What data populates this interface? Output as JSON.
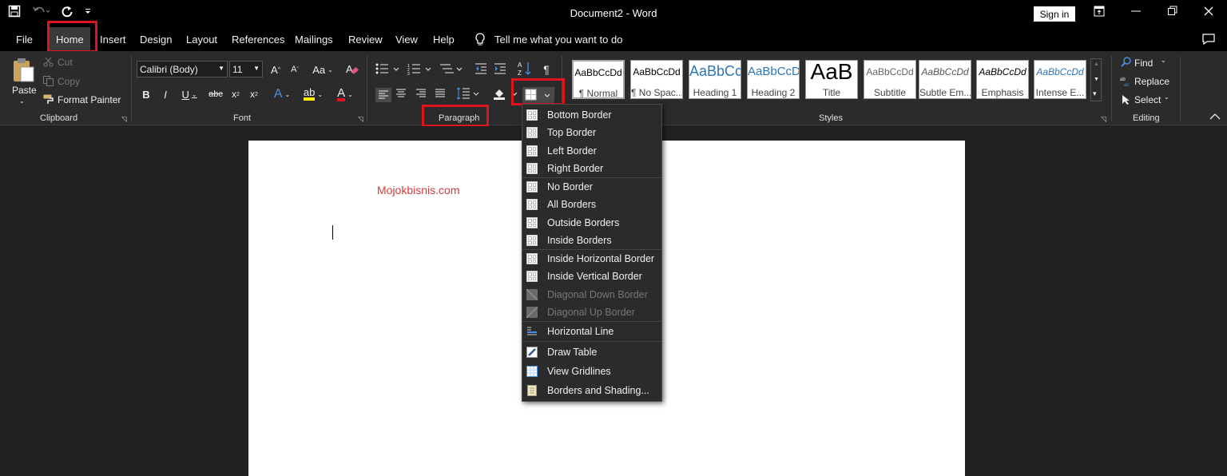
{
  "titlebar": {
    "title": "Document2  -  Word",
    "signin": "Sign in"
  },
  "menu": {
    "tabs": [
      "File",
      "Home",
      "Insert",
      "Design",
      "Layout",
      "References",
      "Mailings",
      "Review",
      "View",
      "Help"
    ],
    "tellme": "Tell me what you want to do"
  },
  "ribbon": {
    "clipboard": {
      "paste": "Paste",
      "cut": "Cut",
      "copy": "Copy",
      "format_painter": "Format Painter",
      "label": "Clipboard"
    },
    "font": {
      "font_name": "Calibri (Body)",
      "font_size": "11",
      "label": "Font"
    },
    "paragraph": {
      "label": "Paragraph"
    },
    "styles": {
      "items": [
        {
          "preview": "AaBbCcDd",
          "name": "¶ Normal"
        },
        {
          "preview": "AaBbCcDd",
          "name": "¶ No Spac..."
        },
        {
          "preview": "AaBbCc",
          "name": "Heading 1"
        },
        {
          "preview": "AaBbCcD",
          "name": "Heading 2"
        },
        {
          "preview": "AaB",
          "name": "Title"
        },
        {
          "preview": "AaBbCcDd",
          "name": "Subtitle"
        },
        {
          "preview": "AaBbCcDd",
          "name": "Subtle Em..."
        },
        {
          "preview": "AaBbCcDd",
          "name": "Emphasis"
        },
        {
          "preview": "AaBbCcDd",
          "name": "Intense E..."
        }
      ],
      "label": "Styles"
    },
    "editing": {
      "find": "Find",
      "replace": "Replace",
      "select": "Select",
      "label": "Editing"
    }
  },
  "document": {
    "watermark": "Mojokbisnis.com"
  },
  "borders_menu": {
    "items": [
      {
        "label": "Bottom Border",
        "enabled": true
      },
      {
        "label": "Top Border",
        "enabled": true
      },
      {
        "label": "Left Border",
        "enabled": true
      },
      {
        "label": "Right Border",
        "enabled": true
      },
      {
        "label": "No Border",
        "enabled": true
      },
      {
        "label": "All Borders",
        "enabled": true
      },
      {
        "label": "Outside Borders",
        "enabled": true
      },
      {
        "label": "Inside Borders",
        "enabled": true
      },
      {
        "label": "Inside Horizontal Border",
        "enabled": true
      },
      {
        "label": "Inside Vertical Border",
        "enabled": true
      },
      {
        "label": "Diagonal Down Border",
        "enabled": false
      },
      {
        "label": "Diagonal Up Border",
        "enabled": false
      },
      {
        "label": "Horizontal Line",
        "enabled": true
      },
      {
        "label": "Draw Table",
        "enabled": true
      },
      {
        "label": "View Gridlines",
        "enabled": true
      },
      {
        "label": "Borders and Shading...",
        "enabled": true
      }
    ]
  },
  "colors": {
    "highlight_red": "#e0141e",
    "watermark_red": "#d33a3a"
  }
}
